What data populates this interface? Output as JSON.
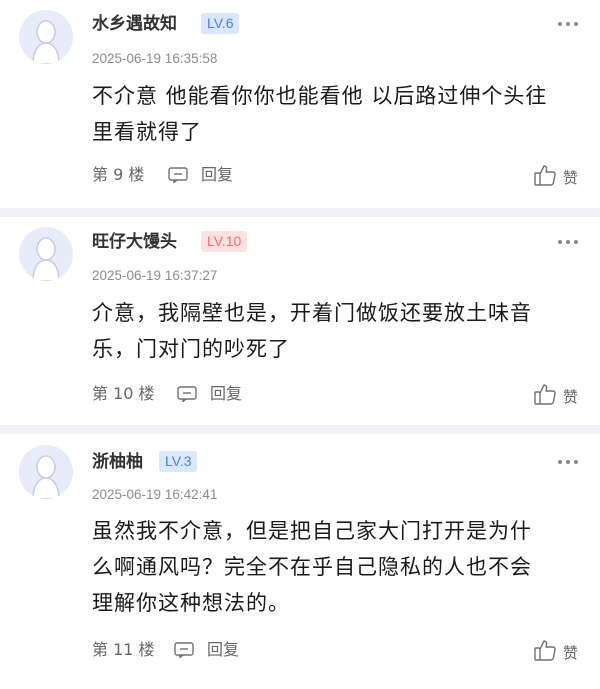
{
  "comments": [
    {
      "username": "水乡遇故知",
      "level": "LV.6",
      "level_color": "#4d7fe0",
      "time": "2025-06-19 16:35:58",
      "content_lines": [
        "不介意 他能看你你也能看他 以后路过伸个头往",
        "里看就得了"
      ],
      "floor": "第 9 楼",
      "reply_label": "回复",
      "like_label": "赞"
    },
    {
      "username": "旺仔大馒头",
      "level": "LV.10",
      "level_color": "#ee6e6e",
      "time": "2025-06-19 16:37:27",
      "content_lines": [
        "介意，我隔壁也是，开着门做饭还要放土味音",
        "乐，门对门的吵死了"
      ],
      "floor": "第 10 楼",
      "reply_label": "回复",
      "like_label": "赞"
    },
    {
      "username": "浙柚柚",
      "level": "LV.3",
      "level_color": "#4d7fe0",
      "time": "2025-06-19 16:42:41",
      "content_lines": [
        "虽然我不介意，但是把自己家大门打开是为什",
        "么啊通风吗？完全不在乎自己隐私的人也不会",
        "理解你这种想法的。"
      ],
      "floor": "第 11 楼",
      "reply_label": "回复",
      "like_label": "赞"
    }
  ],
  "icons": {
    "avatar": "avatar-silhouette-icon",
    "more": "more-dots-icon",
    "reply": "reply-comment-icon",
    "like": "thumbs-up-icon"
  }
}
